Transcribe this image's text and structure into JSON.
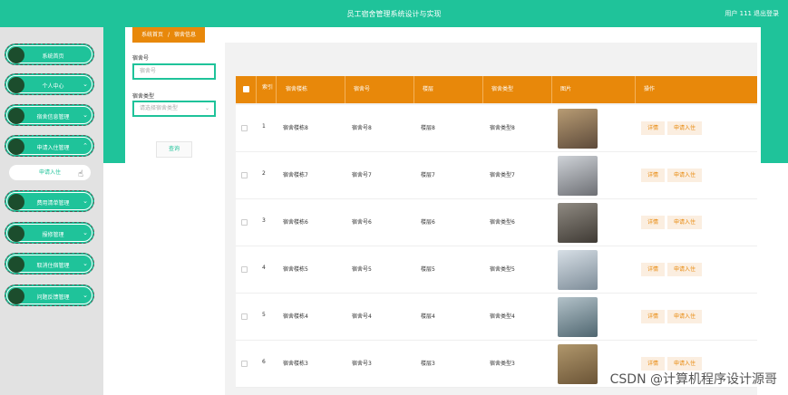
{
  "header": {
    "title": "员工宿舍管理系统设计与实现",
    "user": "用户 111",
    "logout": "退出登录"
  },
  "sidebar": {
    "items": [
      {
        "label": "系统首页",
        "chevron": ""
      },
      {
        "label": "个人中心",
        "chevron": "⌄"
      },
      {
        "label": "宿舍信息管理",
        "chevron": "⌄"
      },
      {
        "label": "申请入住管理",
        "chevron": "⌃"
      },
      {
        "label": "费用清单管理",
        "chevron": "⌄"
      },
      {
        "label": "报修管理",
        "chevron": "⌄"
      },
      {
        "label": "取消住宿管理",
        "chevron": "⌄"
      },
      {
        "label": "问题反馈管理",
        "chevron": "⌄"
      }
    ],
    "sub_item": "申请入住"
  },
  "breadcrumb": {
    "home": "系统首页",
    "sep": "/",
    "current": "宿舍信息"
  },
  "search": {
    "label1": "宿舍号",
    "placeholder1": "宿舍号",
    "label2": "宿舍类型",
    "placeholder2": "请选择宿舍类型",
    "button": "查询"
  },
  "table": {
    "headers": [
      "索引",
      "宿舍楼栋",
      "宿舍号",
      "楼层",
      "宿舍类型",
      "图片",
      "操作"
    ],
    "rows": [
      {
        "index": "1",
        "building": "宿舍楼栋8",
        "room": "宿舍号8",
        "floor": "楼层8",
        "type": "宿舍类型8"
      },
      {
        "index": "2",
        "building": "宿舍楼栋7",
        "room": "宿舍号7",
        "floor": "楼层7",
        "type": "宿舍类型7"
      },
      {
        "index": "3",
        "building": "宿舍楼栋6",
        "room": "宿舍号6",
        "floor": "楼层6",
        "type": "宿舍类型6"
      },
      {
        "index": "4",
        "building": "宿舍楼栋5",
        "room": "宿舍号5",
        "floor": "楼层5",
        "type": "宿舍类型5"
      },
      {
        "index": "5",
        "building": "宿舍楼栋4",
        "room": "宿舍号4",
        "floor": "楼层4",
        "type": "宿舍类型4"
      },
      {
        "index": "6",
        "building": "宿舍楼栋3",
        "room": "宿舍号3",
        "floor": "楼层3",
        "type": "宿舍类型3"
      }
    ],
    "detail_label": "详情",
    "apply_label": "申请入住"
  },
  "watermark": "CSDN @计算机程序设计源哥",
  "colors": {
    "primary": "#1fc39a",
    "accent": "#e8880a",
    "menu_dot": "#1c4d2d"
  }
}
